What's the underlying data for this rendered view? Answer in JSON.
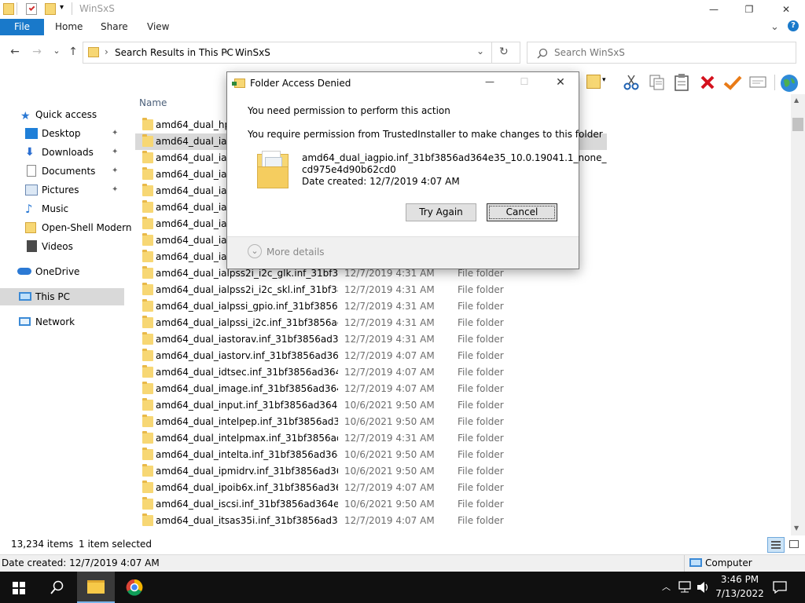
{
  "window": {
    "title": "WinSxS",
    "minimize": "—",
    "maximize": "❐",
    "close": "✕"
  },
  "ribbon": {
    "tabs": [
      "File",
      "Home",
      "Share",
      "View"
    ],
    "expand": "⌄",
    "help": "?"
  },
  "address": {
    "breadcrumb": [
      "Search Results in This PC",
      "WinSxS"
    ],
    "separator": "›",
    "refresh": "↻",
    "dropdown": "⌄"
  },
  "search": {
    "placeholder": "Search WinSxS"
  },
  "nav": {
    "back": "←",
    "forward": "→",
    "recent": "⌄",
    "up": "↑"
  },
  "sidebar": {
    "items": [
      {
        "label": "Quick access",
        "icon": "star-icon",
        "color": "#2b79d4"
      },
      {
        "label": "Desktop",
        "icon": "desktop-icon",
        "color": "#1f7fd8",
        "pinned": true
      },
      {
        "label": "Downloads",
        "icon": "download-icon",
        "color": "#2c6fd1",
        "pinned": true
      },
      {
        "label": "Documents",
        "icon": "document-icon",
        "color": "#8a8a8a",
        "pinned": true
      },
      {
        "label": "Pictures",
        "icon": "pictures-icon",
        "color": "#6b89b3",
        "pinned": true
      },
      {
        "label": "Music",
        "icon": "music-icon",
        "color": "#2b79d4"
      },
      {
        "label": "Open-Shell Modern",
        "icon": "folder-icon",
        "color": "#f7d774"
      },
      {
        "label": "Videos",
        "icon": "videos-icon",
        "color": "#4a4a4a"
      },
      {
        "label": "OneDrive",
        "icon": "onedrive-icon",
        "color": "#2b79d4"
      },
      {
        "label": "This PC",
        "icon": "computer-icon",
        "color": "#3b8ad6"
      },
      {
        "label": "Network",
        "icon": "network-icon",
        "color": "#3b8ad6"
      }
    ],
    "pin_glyph": "📌"
  },
  "filelist": {
    "column_name": "Name",
    "rows": [
      {
        "name": "amd64_dual_hpsa",
        "date": "",
        "type": ""
      },
      {
        "name": "amd64_dual_iagp",
        "date": "",
        "type": ""
      },
      {
        "name": "amd64_dual_iai2c",
        "date": "",
        "type": ""
      },
      {
        "name": "amd64_dual_ialps",
        "date": "",
        "type": ""
      },
      {
        "name": "amd64_dual_ialps",
        "date": "",
        "type": ""
      },
      {
        "name": "amd64_dual_ialps",
        "date": "",
        "type": ""
      },
      {
        "name": "amd64_dual_ialps",
        "date": "",
        "type": ""
      },
      {
        "name": "amd64_dual_ialps",
        "date": "",
        "type": ""
      },
      {
        "name": "amd64_dual_ialps",
        "date": "",
        "type": ""
      },
      {
        "name": "amd64_dual_ialpss2i_i2c_glk.inf_31bf3856...",
        "date": "12/7/2019 4:31 AM",
        "type": "File folder"
      },
      {
        "name": "amd64_dual_ialpss2i_i2c_skl.inf_31bf3856...",
        "date": "12/7/2019 4:31 AM",
        "type": "File folder"
      },
      {
        "name": "amd64_dual_ialpssi_gpio.inf_31bf3856ad...",
        "date": "12/7/2019 4:31 AM",
        "type": "File folder"
      },
      {
        "name": "amd64_dual_ialpssi_i2c.inf_31bf3856ad36...",
        "date": "12/7/2019 4:31 AM",
        "type": "File folder"
      },
      {
        "name": "amd64_dual_iastorav.inf_31bf3856ad364e...",
        "date": "12/7/2019 4:31 AM",
        "type": "File folder"
      },
      {
        "name": "amd64_dual_iastorv.inf_31bf3856ad364e3...",
        "date": "12/7/2019 4:07 AM",
        "type": "File folder"
      },
      {
        "name": "amd64_dual_idtsec.inf_31bf3856ad364e3...",
        "date": "12/7/2019 4:07 AM",
        "type": "File folder"
      },
      {
        "name": "amd64_dual_image.inf_31bf3856ad364e3...",
        "date": "12/7/2019 4:07 AM",
        "type": "File folder"
      },
      {
        "name": "amd64_dual_input.inf_31bf3856ad364e35...",
        "date": "10/6/2021 9:50 AM",
        "type": "File folder"
      },
      {
        "name": "amd64_dual_intelpep.inf_31bf3856ad364...",
        "date": "10/6/2021 9:50 AM",
        "type": "File folder"
      },
      {
        "name": "amd64_dual_intelpmax.inf_31bf3856ad36...",
        "date": "12/7/2019 4:31 AM",
        "type": "File folder"
      },
      {
        "name": "amd64_dual_intelta.inf_31bf3856ad364e3...",
        "date": "10/6/2021 9:50 AM",
        "type": "File folder"
      },
      {
        "name": "amd64_dual_ipmidrv.inf_31bf3856ad364e...",
        "date": "10/6/2021 9:50 AM",
        "type": "File folder"
      },
      {
        "name": "amd64_dual_ipoib6x.inf_31bf3856ad364e...",
        "date": "12/7/2019 4:07 AM",
        "type": "File folder"
      },
      {
        "name": "amd64_dual_iscsi.inf_31bf3856ad364e35_...",
        "date": "10/6/2021 9:50 AM",
        "type": "File folder"
      },
      {
        "name": "amd64_dual_itsas35i.inf_31bf3856ad364e...",
        "date": "12/7/2019 4:07 AM",
        "type": "File folder"
      }
    ]
  },
  "status": {
    "item_count": "13,234 items",
    "selected": "1 item selected"
  },
  "details_bar": {
    "date_created": "Date created: 12/7/2019 4:07 AM",
    "location": "Computer"
  },
  "dialog": {
    "title": "Folder Access Denied",
    "heading": "You need permission to perform this action",
    "message": "You require permission from TrustedInstaller to make changes to this folder",
    "file_name_line1": "amd64_dual_iagpio.inf_31bf3856ad364e35_10.0.19041.1_none_",
    "file_name_line2": "cd975e4d90b62cd0",
    "file_date": "Date created: 12/7/2019 4:07 AM",
    "try_again": "Try Again",
    "cancel": "Cancel",
    "more_details": "More details",
    "minimize": "—",
    "maximize": "☐",
    "close": "✕"
  },
  "taskbar": {
    "time": "3:46 PM",
    "date": "7/13/2022"
  },
  "colors": {
    "accent": "#1979ca",
    "selection": "#cce8ff",
    "folder": "#f7d774"
  }
}
